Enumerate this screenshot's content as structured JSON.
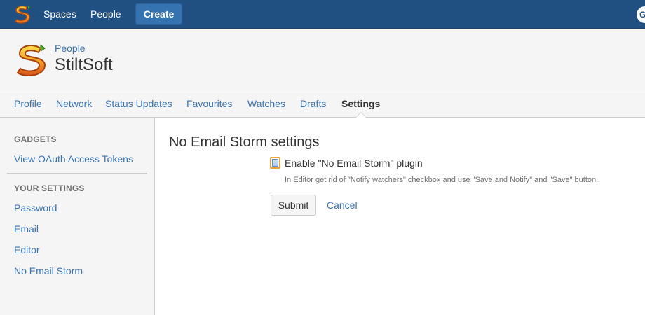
{
  "topbar": {
    "logo_icon": "stiltsoft-s-logo-icon",
    "nav": [
      {
        "label": "Spaces"
      },
      {
        "label": "People"
      }
    ],
    "create_label": "Create",
    "avatar_initial": "G",
    "bg_color": "#205081"
  },
  "profile": {
    "logo_icon": "stiltsoft-s-logo-icon",
    "breadcrumb": "People",
    "title": "StiltSoft"
  },
  "tabs": [
    {
      "label": "Profile",
      "active": false
    },
    {
      "label": "Network",
      "active": false
    },
    {
      "label": "Status Updates",
      "active": false
    },
    {
      "label": "Favourites",
      "active": false
    },
    {
      "label": "Watches",
      "active": false
    },
    {
      "label": "Drafts",
      "active": false
    },
    {
      "label": "Settings",
      "active": true
    }
  ],
  "sidebar": {
    "gadgets_heading": "GADGETS",
    "gadgets_items": [
      {
        "label": "View OAuth Access Tokens"
      }
    ],
    "settings_heading": "YOUR SETTINGS",
    "settings_items": [
      {
        "label": "Password"
      },
      {
        "label": "Email"
      },
      {
        "label": "Editor"
      },
      {
        "label": "No Email Storm"
      }
    ]
  },
  "main": {
    "title": "No Email Storm settings",
    "checkbox_label": "Enable \"No Email Storm\" plugin",
    "checkbox_checked": false,
    "description": "In Editor get rid of \"Notify watchers\" checkbox and use \"Save and Notify\" and \"Save\" button.",
    "submit_label": "Submit",
    "cancel_label": "Cancel"
  },
  "colors": {
    "link": "#3b73af",
    "header": "#205081",
    "accent_checkbox": "#e8a33e"
  }
}
